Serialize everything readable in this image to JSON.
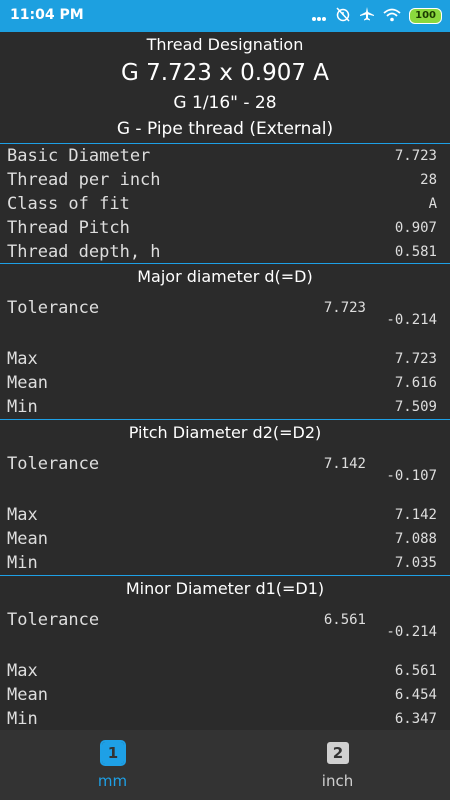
{
  "status": {
    "time": "11:04 PM",
    "battery": "100",
    "icons": [
      "more-dots-icon",
      "alarm-off-icon",
      "airplane-icon",
      "wifi-icon",
      "battery-icon"
    ]
  },
  "header": {
    "designation_label": "Thread Designation",
    "designation": "G 7.723 x 0.907   A",
    "size": "G 1/16\" - 28",
    "thread_type": "G - Pipe thread (External)"
  },
  "basic": {
    "rows": [
      {
        "label": "Basic Diameter",
        "value": "7.723"
      },
      {
        "label": "Thread per inch",
        "value": "28"
      },
      {
        "label": "Class of fit",
        "value": "A"
      },
      {
        "label": "Thread Pitch",
        "value": "0.907"
      },
      {
        "label": "Thread depth, h",
        "value": "0.581"
      }
    ]
  },
  "sections": [
    {
      "title": "Major diameter d(=D)",
      "tolerance_label": "Tolerance",
      "tolerance_base": "7.723",
      "tolerance_dev": "-0.214",
      "max_label": "Max",
      "max": "7.723",
      "mean_label": "Mean",
      "mean": "7.616",
      "min_label": "Min",
      "min": "7.509"
    },
    {
      "title": "Pitch Diameter d2(=D2)",
      "tolerance_label": "Tolerance",
      "tolerance_base": "7.142",
      "tolerance_dev": "-0.107",
      "max_label": "Max",
      "max": "7.142",
      "mean_label": "Mean",
      "mean": "7.088",
      "min_label": "Min",
      "min": "7.035"
    },
    {
      "title": "Minor Diameter d1(=D1)",
      "tolerance_label": "Tolerance",
      "tolerance_base": "6.561",
      "tolerance_dev": "-0.214",
      "max_label": "Max",
      "max": "6.561",
      "mean_label": "Mean",
      "mean": "6.454",
      "min_label": "Min",
      "min": "6.347"
    }
  ],
  "nav": {
    "tabs": [
      {
        "badge": "1",
        "label": "mm",
        "active": true
      },
      {
        "badge": "2",
        "label": "inch",
        "active": false
      }
    ]
  },
  "colors": {
    "accent": "#1ea0e6",
    "status_bar": "#1da0e0",
    "background": "#2b2b2b",
    "nav_background": "#333333",
    "inactive": "#d0d0d0"
  }
}
